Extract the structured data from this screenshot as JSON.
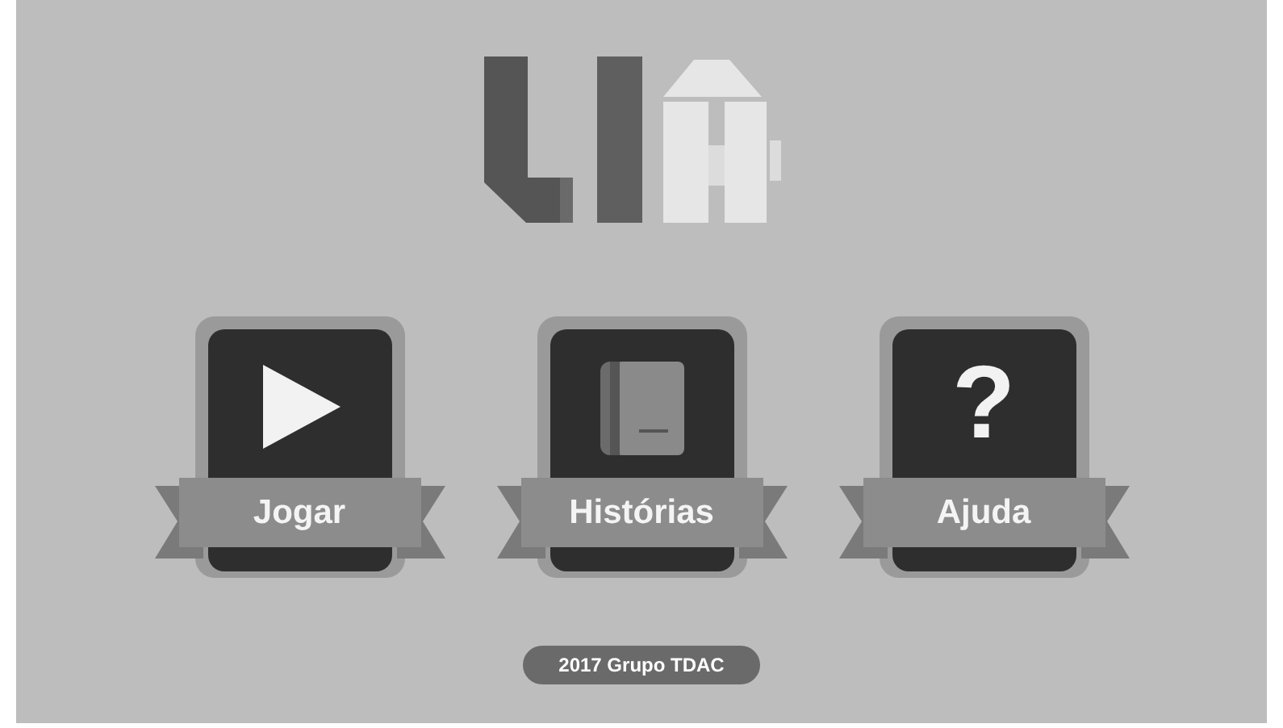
{
  "menu": [
    {
      "label": "Jogar",
      "kind": "play"
    },
    {
      "label": "Histórias",
      "kind": "book"
    },
    {
      "label": "Ajuda",
      "kind": "question",
      "glyph": "?"
    }
  ],
  "footer": {
    "text": "2017 Grupo TDAC"
  }
}
